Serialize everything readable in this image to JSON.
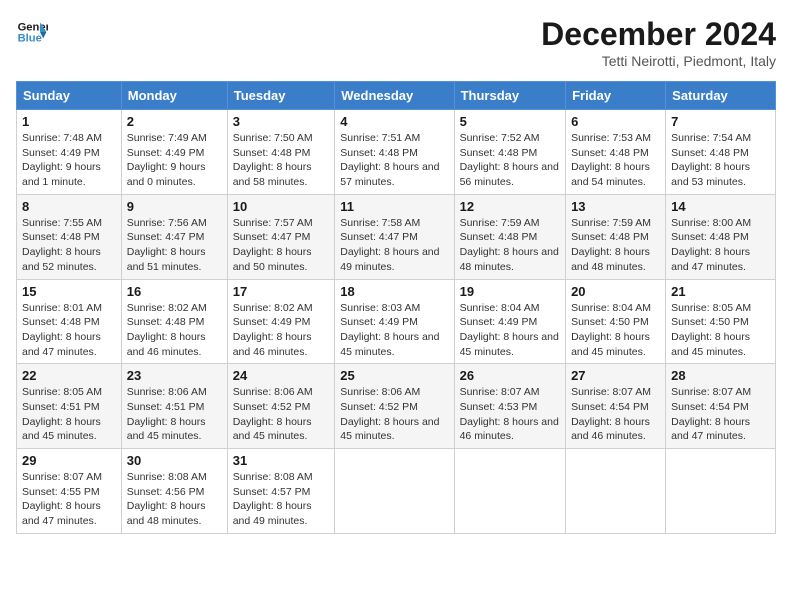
{
  "header": {
    "logo_line1": "General",
    "logo_line2": "Blue",
    "month_title": "December 2024",
    "location": "Tetti Neirotti, Piedmont, Italy"
  },
  "days_of_week": [
    "Sunday",
    "Monday",
    "Tuesday",
    "Wednesday",
    "Thursday",
    "Friday",
    "Saturday"
  ],
  "weeks": [
    [
      {
        "day": "1",
        "sunrise": "7:48 AM",
        "sunset": "4:49 PM",
        "daylight": "9 hours and 1 minute."
      },
      {
        "day": "2",
        "sunrise": "7:49 AM",
        "sunset": "4:49 PM",
        "daylight": "9 hours and 0 minutes."
      },
      {
        "day": "3",
        "sunrise": "7:50 AM",
        "sunset": "4:48 PM",
        "daylight": "8 hours and 58 minutes."
      },
      {
        "day": "4",
        "sunrise": "7:51 AM",
        "sunset": "4:48 PM",
        "daylight": "8 hours and 57 minutes."
      },
      {
        "day": "5",
        "sunrise": "7:52 AM",
        "sunset": "4:48 PM",
        "daylight": "8 hours and 56 minutes."
      },
      {
        "day": "6",
        "sunrise": "7:53 AM",
        "sunset": "4:48 PM",
        "daylight": "8 hours and 54 minutes."
      },
      {
        "day": "7",
        "sunrise": "7:54 AM",
        "sunset": "4:48 PM",
        "daylight": "8 hours and 53 minutes."
      }
    ],
    [
      {
        "day": "8",
        "sunrise": "7:55 AM",
        "sunset": "4:48 PM",
        "daylight": "8 hours and 52 minutes."
      },
      {
        "day": "9",
        "sunrise": "7:56 AM",
        "sunset": "4:47 PM",
        "daylight": "8 hours and 51 minutes."
      },
      {
        "day": "10",
        "sunrise": "7:57 AM",
        "sunset": "4:47 PM",
        "daylight": "8 hours and 50 minutes."
      },
      {
        "day": "11",
        "sunrise": "7:58 AM",
        "sunset": "4:47 PM",
        "daylight": "8 hours and 49 minutes."
      },
      {
        "day": "12",
        "sunrise": "7:59 AM",
        "sunset": "4:48 PM",
        "daylight": "8 hours and 48 minutes."
      },
      {
        "day": "13",
        "sunrise": "7:59 AM",
        "sunset": "4:48 PM",
        "daylight": "8 hours and 48 minutes."
      },
      {
        "day": "14",
        "sunrise": "8:00 AM",
        "sunset": "4:48 PM",
        "daylight": "8 hours and 47 minutes."
      }
    ],
    [
      {
        "day": "15",
        "sunrise": "8:01 AM",
        "sunset": "4:48 PM",
        "daylight": "8 hours and 47 minutes."
      },
      {
        "day": "16",
        "sunrise": "8:02 AM",
        "sunset": "4:48 PM",
        "daylight": "8 hours and 46 minutes."
      },
      {
        "day": "17",
        "sunrise": "8:02 AM",
        "sunset": "4:49 PM",
        "daylight": "8 hours and 46 minutes."
      },
      {
        "day": "18",
        "sunrise": "8:03 AM",
        "sunset": "4:49 PM",
        "daylight": "8 hours and 45 minutes."
      },
      {
        "day": "19",
        "sunrise": "8:04 AM",
        "sunset": "4:49 PM",
        "daylight": "8 hours and 45 minutes."
      },
      {
        "day": "20",
        "sunrise": "8:04 AM",
        "sunset": "4:50 PM",
        "daylight": "8 hours and 45 minutes."
      },
      {
        "day": "21",
        "sunrise": "8:05 AM",
        "sunset": "4:50 PM",
        "daylight": "8 hours and 45 minutes."
      }
    ],
    [
      {
        "day": "22",
        "sunrise": "8:05 AM",
        "sunset": "4:51 PM",
        "daylight": "8 hours and 45 minutes."
      },
      {
        "day": "23",
        "sunrise": "8:06 AM",
        "sunset": "4:51 PM",
        "daylight": "8 hours and 45 minutes."
      },
      {
        "day": "24",
        "sunrise": "8:06 AM",
        "sunset": "4:52 PM",
        "daylight": "8 hours and 45 minutes."
      },
      {
        "day": "25",
        "sunrise": "8:06 AM",
        "sunset": "4:52 PM",
        "daylight": "8 hours and 45 minutes."
      },
      {
        "day": "26",
        "sunrise": "8:07 AM",
        "sunset": "4:53 PM",
        "daylight": "8 hours and 46 minutes."
      },
      {
        "day": "27",
        "sunrise": "8:07 AM",
        "sunset": "4:54 PM",
        "daylight": "8 hours and 46 minutes."
      },
      {
        "day": "28",
        "sunrise": "8:07 AM",
        "sunset": "4:54 PM",
        "daylight": "8 hours and 47 minutes."
      }
    ],
    [
      {
        "day": "29",
        "sunrise": "8:07 AM",
        "sunset": "4:55 PM",
        "daylight": "8 hours and 47 minutes."
      },
      {
        "day": "30",
        "sunrise": "8:08 AM",
        "sunset": "4:56 PM",
        "daylight": "8 hours and 48 minutes."
      },
      {
        "day": "31",
        "sunrise": "8:08 AM",
        "sunset": "4:57 PM",
        "daylight": "8 hours and 49 minutes."
      },
      null,
      null,
      null,
      null
    ]
  ]
}
